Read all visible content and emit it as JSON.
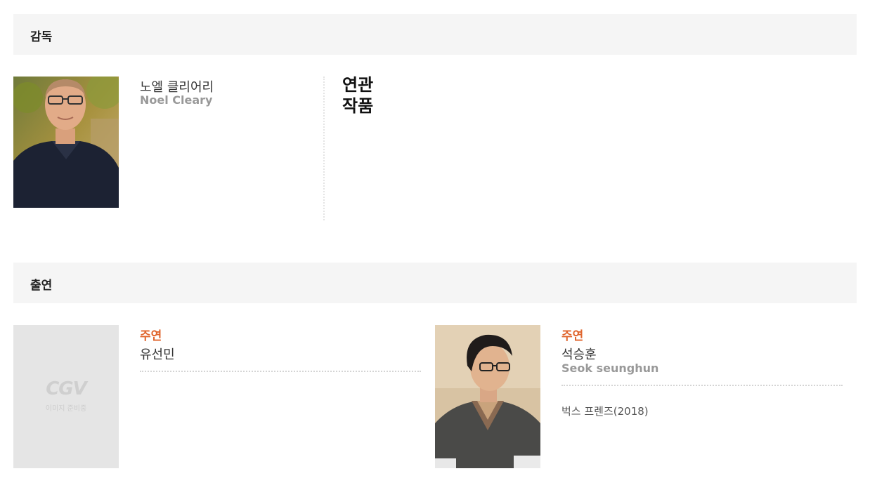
{
  "director_section": {
    "header": "감독",
    "director": {
      "name_ko": "노엘 클리어리",
      "name_en": "Noel Cleary"
    },
    "related_works_title_line1": "연관",
    "related_works_title_line2": "작품"
  },
  "cast_section": {
    "header": "출연",
    "cast": [
      {
        "role": "주연",
        "name_ko": "유선민",
        "placeholder_logo": "CGV",
        "placeholder_text": "이미지 준비중"
      },
      {
        "role": "주연",
        "name_ko": "석승훈",
        "name_en": "Seok seunghun",
        "filmography": "벅스 프렌즈(2018)"
      }
    ]
  },
  "colors": {
    "accent": "#e0662e",
    "header_bg": "#f5f5f5",
    "subtext": "#999999"
  }
}
